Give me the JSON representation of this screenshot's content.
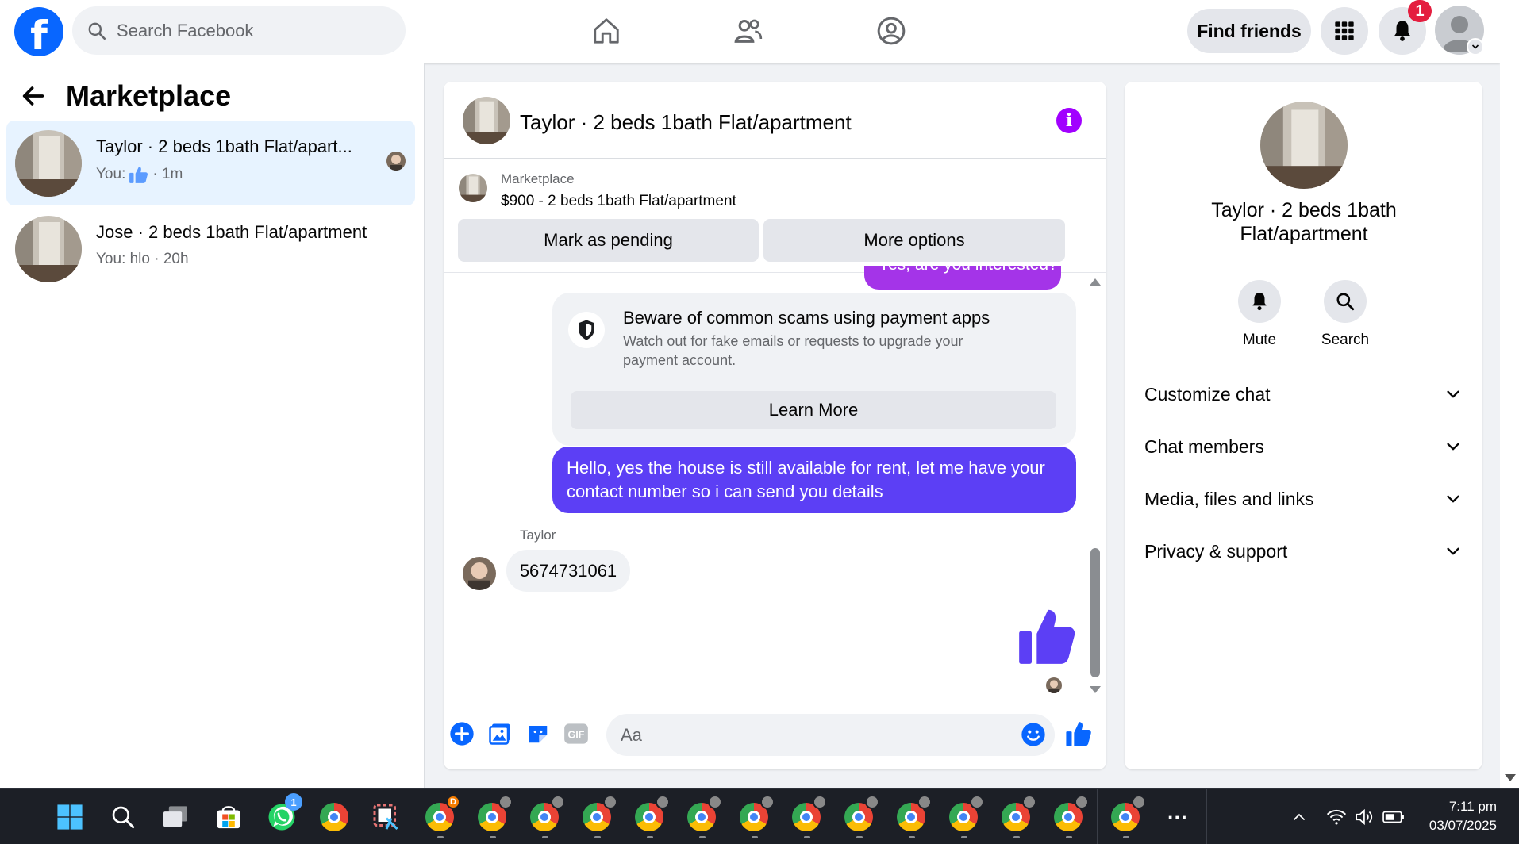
{
  "topbar": {
    "search_placeholder": "Search Facebook",
    "find_friends_label": "Find friends",
    "notification_count": "1"
  },
  "left": {
    "title": "Marketplace",
    "conversations": [
      {
        "name": "Taylor · 2 beds 1bath Flat/apart...",
        "sub_prefix": "You:",
        "sub_time": "· 1m"
      },
      {
        "name": "Jose · 2 beds 1bath Flat/apartment",
        "sub_text": "You: hlo · 20h"
      }
    ]
  },
  "chat": {
    "title": "Taylor · 2 beds 1bath Flat/apartment",
    "listing_label": "Marketplace",
    "listing_price": "$900 - 2 beds 1bath Flat/apartment",
    "mark_pending_label": "Mark as pending",
    "more_options_label": "More options",
    "cut_message": "Yes, are you interested?",
    "scam_title": "Beware of common scams using payment apps",
    "scam_body": "Watch out for fake emails or requests to upgrade your payment account.",
    "learn_more_label": "Learn More",
    "my_message": "Hello, yes the house is still available for rent, let me have your contact number so i can send you details",
    "sender_name": "Taylor",
    "their_message": "5674731061",
    "input_placeholder": "Aa"
  },
  "right": {
    "name": "Taylor · 2 beds 1bath Flat/apartment",
    "mute_label": "Mute",
    "search_label": "Search",
    "sections": [
      "Customize chat",
      "Chat members",
      "Media, files and links",
      "Privacy & support"
    ]
  },
  "taskbar": {
    "time": "7:11 pm",
    "date": "03/07/2025",
    "whatsapp_badge": "1",
    "chrome_badge": "D"
  },
  "colors": {
    "facebook_blue": "#0866ff",
    "my_bubble": "#5c3ff5",
    "info_purple": "#a100ff",
    "notif_red": "#e41e3f"
  }
}
